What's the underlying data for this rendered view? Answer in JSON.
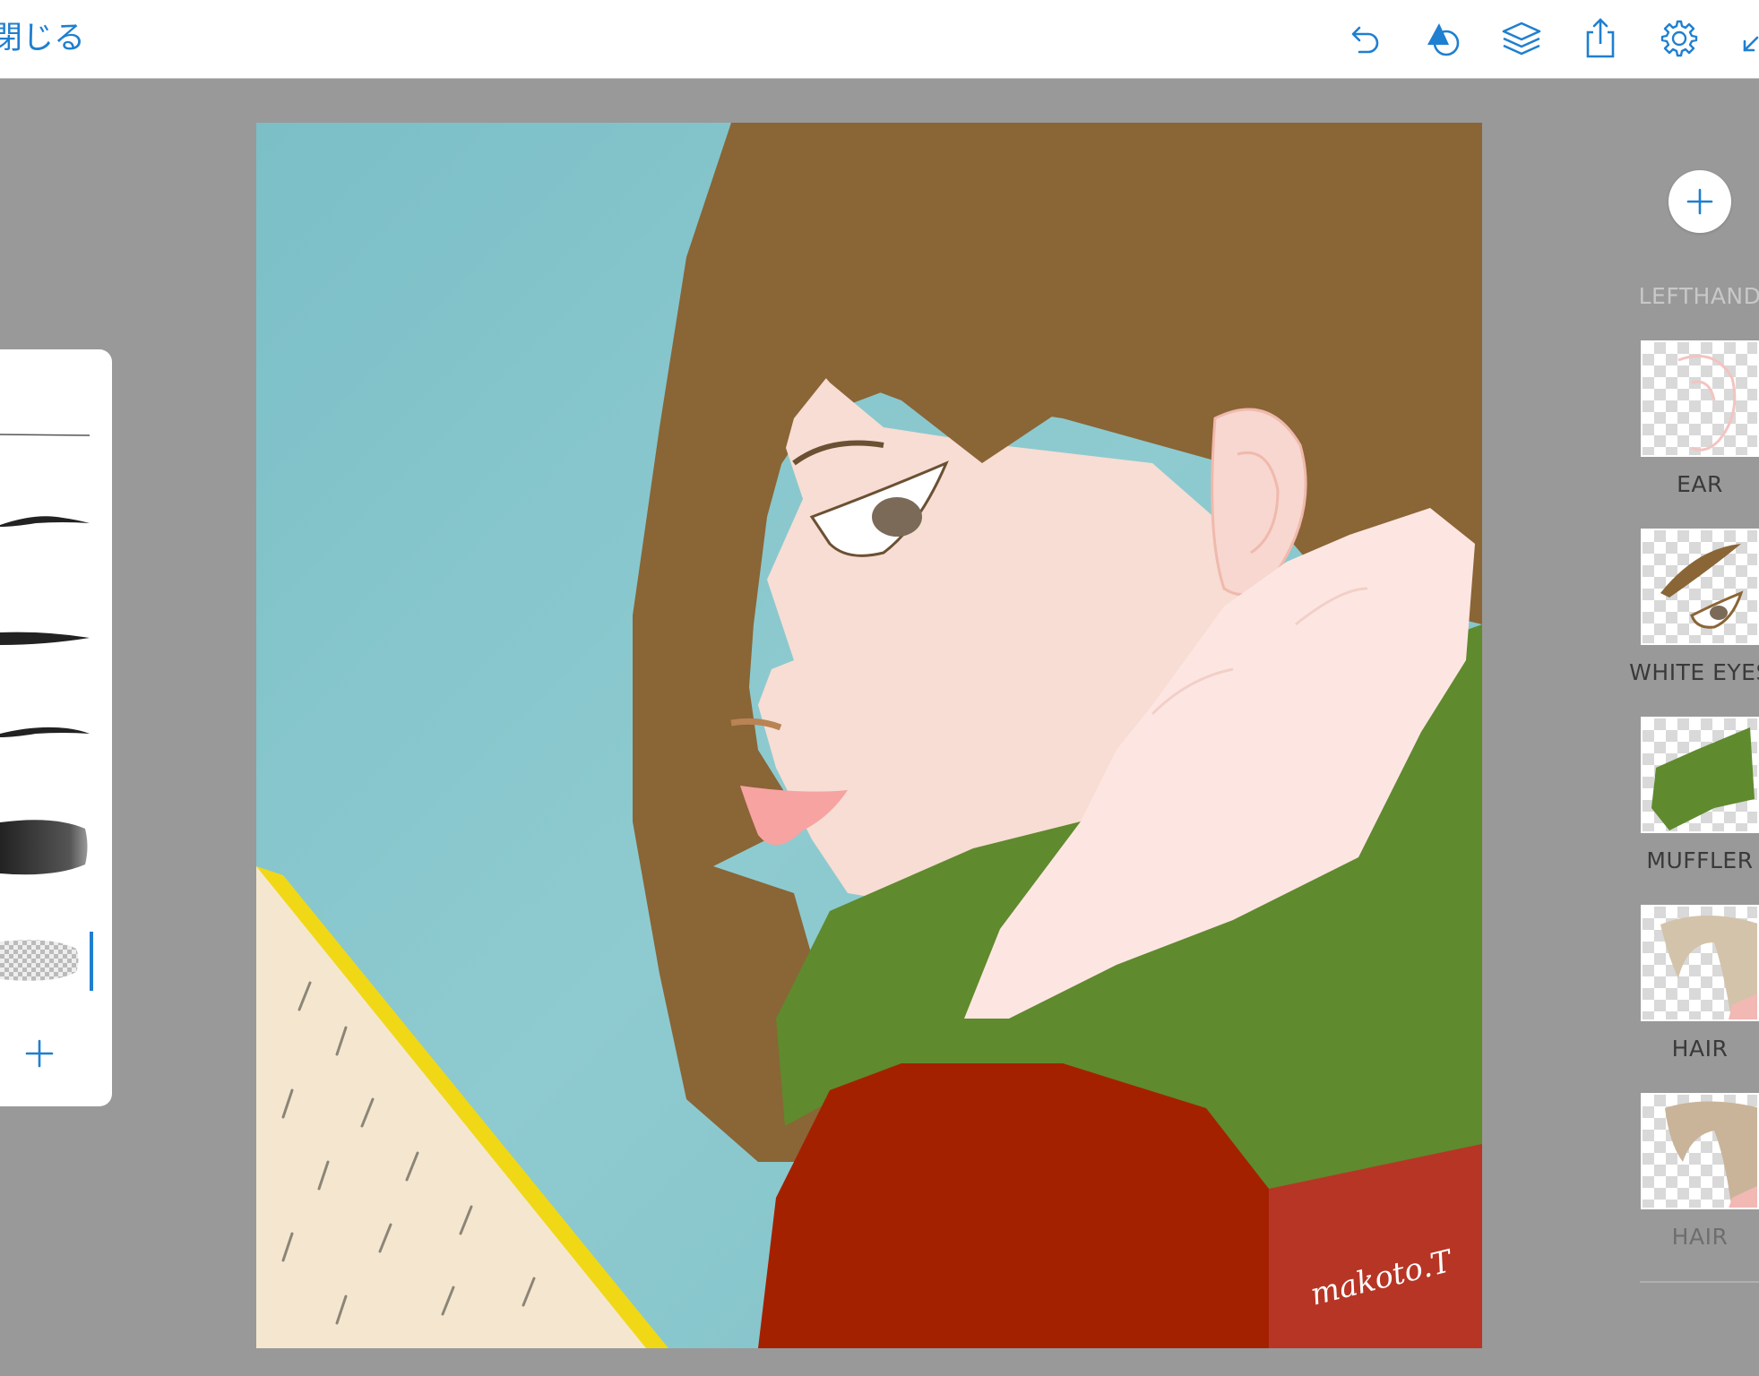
{
  "toolbar": {
    "close_label": "閉じる",
    "icons": [
      "undo-icon",
      "shape-icon",
      "layers-icon",
      "share-icon",
      "settings-icon",
      "collapse-icon"
    ]
  },
  "canvas": {
    "signature": "makoto.T"
  },
  "brush_panel": {
    "brushes": [
      "fine-pen",
      "tapered-brush-1",
      "tapered-brush-2",
      "tapered-brush-3",
      "soft-wash",
      "eraser"
    ],
    "selected": "eraser",
    "add_label": "+"
  },
  "layers": {
    "add_label": "+",
    "items": [
      {
        "label": "LEFTHAND"
      },
      {
        "label": "EAR"
      },
      {
        "label": "WHITE EYES"
      },
      {
        "label": "MUFFLER"
      },
      {
        "label": "HAIR"
      },
      {
        "label": "HAIR"
      }
    ]
  },
  "colors": {
    "accent": "#1f7fd0",
    "workspace": "#999999",
    "sky": "#84c4c9",
    "hair": "#8a6536",
    "skin": "#f7ddd3",
    "hand": "#fde6e2",
    "muffler": "#5f8a2e",
    "coat": "#a42100",
    "book": "#f5e7cf",
    "book_edge": "#f0d817",
    "lips": "#f6a3a1"
  }
}
